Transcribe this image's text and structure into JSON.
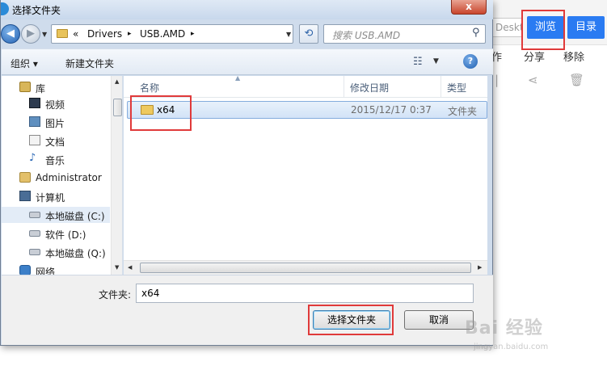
{
  "background_app": {
    "path_placeholder": "Deskto",
    "browse_label": "浏览",
    "directory_label": "目录",
    "actions": [
      "作",
      "分享",
      "移除"
    ]
  },
  "dialog": {
    "title": "选择文件夹",
    "close_label": "x",
    "address": {
      "prefix": "«",
      "crumbs": [
        "Drivers",
        "USB.AMD"
      ],
      "separator": "▸"
    },
    "search_placeholder": "搜索 USB.AMD",
    "toolbar": {
      "organize_label": "组织 ▾",
      "new_folder_label": "新建文件夹"
    },
    "nav": [
      {
        "label": "库",
        "icon": "library-icon",
        "indent": 0
      },
      {
        "label": "视频",
        "icon": "video-icon",
        "indent": 1
      },
      {
        "label": "图片",
        "icon": "pictures-icon",
        "indent": 1
      },
      {
        "label": "文档",
        "icon": "documents-icon",
        "indent": 1
      },
      {
        "label": "音乐",
        "icon": "music-icon",
        "indent": 1
      },
      {
        "label": "Administrator",
        "icon": "user-icon",
        "indent": 0
      },
      {
        "label": "计算机",
        "icon": "computer-icon",
        "indent": 0
      },
      {
        "label": "本地磁盘 (C:)",
        "icon": "drive-icon",
        "indent": 1,
        "selected": true
      },
      {
        "label": "软件 (D:)",
        "icon": "drive-icon",
        "indent": 1
      },
      {
        "label": "本地磁盘 (Q:)",
        "icon": "drive-icon",
        "indent": 1
      },
      {
        "label": "网络",
        "icon": "network-icon",
        "indent": 0
      }
    ],
    "columns": {
      "name": "名称",
      "modified": "修改日期",
      "type": "类型"
    },
    "files": [
      {
        "name": "x64",
        "modified": "2015/12/17 0:37",
        "type": "文件夹"
      }
    ],
    "folder_label": "文件夹:",
    "folder_value": "x64",
    "select_button": "选择文件夹",
    "cancel_button": "取消"
  },
  "watermark": {
    "text": "Bai 经验",
    "url": "jingyan.baidu.com"
  },
  "colors": {
    "highlight": "#e03a3a",
    "accent": "#2a7bf2",
    "selection": "#d2e3f7"
  }
}
